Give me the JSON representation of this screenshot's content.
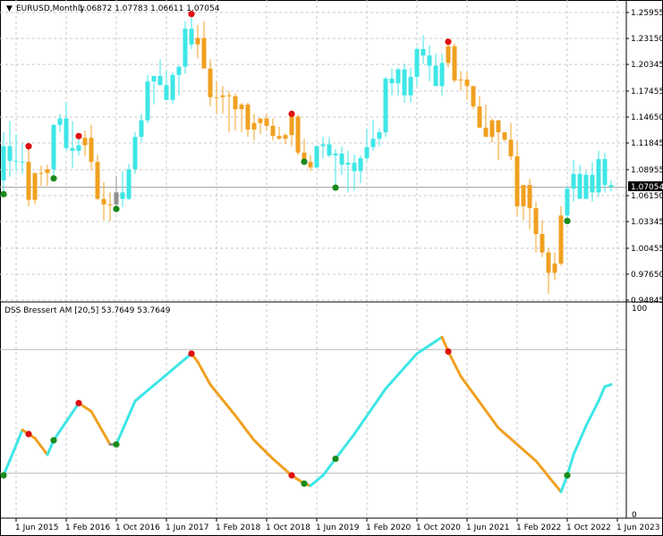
{
  "header": {
    "symbol_title": "EURUSD,Monthly",
    "ohlc": "1.06872 1.07783 1.06611 1.07054",
    "current_price_label": "1.07054"
  },
  "indicator": {
    "title": "DSS Bressert AM [20,5] 53.7649 53.7649",
    "level_max": "100",
    "level_min": "0"
  },
  "colors": {
    "bull": "#3ee6e6",
    "bear": "#f0a020",
    "neutral": "#909090",
    "signal_up": "#1a8a1a",
    "signal_down": "#e01010",
    "grid": "#c8c8c8"
  },
  "chart_data": [
    {
      "type": "candlestick",
      "symbol": "EURUSD",
      "timeframe": "Monthly",
      "ylim": [
        0.94845,
        1.25955
      ],
      "y_ticks": [
        "1.25955",
        "1.23150",
        "1.20345",
        "1.17455",
        "1.14650",
        "1.11845",
        "1.08955",
        "1.06150",
        "1.03345",
        "1.00455",
        "0.97650",
        "0.94845"
      ],
      "x_ticks": [
        "1 Jun 2015",
        "1 Feb 2016",
        "1 Oct 2016",
        "1 Jun 2017",
        "1 Feb 2018",
        "1 Oct 2018",
        "1 Jun 2019",
        "1 Feb 2020",
        "1 Oct 2020",
        "1 Jun 2021",
        "1 Feb 2022",
        "1 Oct 2022",
        "1 Jun 2023"
      ],
      "first_period": "2015-04",
      "current_price": 1.07054,
      "candles": [
        {
          "o": 1.078,
          "h": 1.13,
          "l": 1.066,
          "c": 1.115
        },
        {
          "o": 1.115,
          "h": 1.142,
          "l": 1.082,
          "c": 1.099
        },
        {
          "o": 1.099,
          "h": 1.128,
          "l": 1.088,
          "c": 1.098
        },
        {
          "o": 1.098,
          "h": 1.118,
          "l": 1.085,
          "c": 1.098
        },
        {
          "o": 1.098,
          "h": 1.112,
          "l": 1.05,
          "c": 1.057
        },
        {
          "o": 1.057,
          "h": 1.079,
          "l": 1.052,
          "c": 1.086
        },
        {
          "o": 1.086,
          "h": 1.094,
          "l": 1.072,
          "c": 1.086
        },
        {
          "o": 1.086,
          "h": 1.095,
          "l": 1.072,
          "c": 1.09
        },
        {
          "o": 1.09,
          "h": 1.139,
          "l": 1.083,
          "c": 1.138
        },
        {
          "o": 1.138,
          "h": 1.15,
          "l": 1.13,
          "c": 1.145
        },
        {
          "o": 1.145,
          "h": 1.163,
          "l": 1.11,
          "c": 1.113
        },
        {
          "o": 1.113,
          "h": 1.142,
          "l": 1.091,
          "c": 1.11
        },
        {
          "o": 1.11,
          "h": 1.123,
          "l": 1.105,
          "c": 1.116
        },
        {
          "o": 1.116,
          "h": 1.132,
          "l": 1.104,
          "c": 1.124
        },
        {
          "o": 1.124,
          "h": 1.138,
          "l": 1.089,
          "c": 1.098
        },
        {
          "o": 1.098,
          "h": 1.106,
          "l": 1.057,
          "c": 1.058
        },
        {
          "o": 1.058,
          "h": 1.076,
          "l": 1.035,
          "c": 1.052
        },
        {
          "o": 1.052,
          "h": 1.065,
          "l": 1.034,
          "c": 1.052
        },
        {
          "o": 1.052,
          "h": 1.083,
          "l": 1.05,
          "c": 1.065
        },
        {
          "o": 1.065,
          "h": 1.088,
          "l": 1.049,
          "c": 1.058
        },
        {
          "o": 1.058,
          "h": 1.096,
          "l": 1.057,
          "c": 1.09
        },
        {
          "o": 1.09,
          "h": 1.13,
          "l": 1.085,
          "c": 1.125
        },
        {
          "o": 1.125,
          "h": 1.15,
          "l": 1.12,
          "c": 1.143
        },
        {
          "o": 1.143,
          "h": 1.192,
          "l": 1.14,
          "c": 1.185
        },
        {
          "o": 1.185,
          "h": 1.191,
          "l": 1.16,
          "c": 1.191
        },
        {
          "o": 1.191,
          "h": 1.209,
          "l": 1.181,
          "c": 1.181
        },
        {
          "o": 1.181,
          "h": 1.197,
          "l": 1.165,
          "c": 1.165
        },
        {
          "o": 1.165,
          "h": 1.195,
          "l": 1.161,
          "c": 1.192
        },
        {
          "o": 1.192,
          "h": 1.202,
          "l": 1.17,
          "c": 1.201
        },
        {
          "o": 1.201,
          "h": 1.25,
          "l": 1.193,
          "c": 1.242
        },
        {
          "o": 1.242,
          "h": 1.255,
          "l": 1.22,
          "c": 1.225
        },
        {
          "o": 1.225,
          "h": 1.246,
          "l": 1.21,
          "c": 1.232
        },
        {
          "o": 1.232,
          "h": 1.25,
          "l": 1.217,
          "c": 1.199
        },
        {
          "o": 1.199,
          "h": 1.209,
          "l": 1.158,
          "c": 1.168
        },
        {
          "o": 1.168,
          "h": 1.185,
          "l": 1.15,
          "c": 1.168
        },
        {
          "o": 1.168,
          "h": 1.18,
          "l": 1.15,
          "c": 1.17
        },
        {
          "o": 1.17,
          "h": 1.175,
          "l": 1.13,
          "c": 1.169
        },
        {
          "o": 1.169,
          "h": 1.172,
          "l": 1.132,
          "c": 1.155
        },
        {
          "o": 1.155,
          "h": 1.162,
          "l": 1.13,
          "c": 1.16
        },
        {
          "o": 1.16,
          "h": 1.162,
          "l": 1.125,
          "c": 1.133
        },
        {
          "o": 1.133,
          "h": 1.15,
          "l": 1.121,
          "c": 1.14
        },
        {
          "o": 1.14,
          "h": 1.144,
          "l": 1.128,
          "c": 1.145
        },
        {
          "o": 1.145,
          "h": 1.15,
          "l": 1.132,
          "c": 1.137
        },
        {
          "o": 1.137,
          "h": 1.145,
          "l": 1.121,
          "c": 1.126
        },
        {
          "o": 1.126,
          "h": 1.136,
          "l": 1.122,
          "c": 1.123
        },
        {
          "o": 1.123,
          "h": 1.129,
          "l": 1.117,
          "c": 1.127
        },
        {
          "o": 1.127,
          "h": 1.147,
          "l": 1.115,
          "c": 1.147
        },
        {
          "o": 1.147,
          "h": 1.149,
          "l": 1.105,
          "c": 1.108
        },
        {
          "o": 1.108,
          "h": 1.123,
          "l": 1.101,
          "c": 1.098
        },
        {
          "o": 1.098,
          "h": 1.105,
          "l": 1.088,
          "c": 1.092
        },
        {
          "o": 1.092,
          "h": 1.115,
          "l": 1.091,
          "c": 1.115
        },
        {
          "o": 1.115,
          "h": 1.125,
          "l": 1.102,
          "c": 1.117
        },
        {
          "o": 1.117,
          "h": 1.125,
          "l": 1.103,
          "c": 1.105
        },
        {
          "o": 1.105,
          "h": 1.112,
          "l": 1.073,
          "c": 1.107
        },
        {
          "o": 1.107,
          "h": 1.115,
          "l": 1.084,
          "c": 1.095
        },
        {
          "o": 1.095,
          "h": 1.11,
          "l": 1.065,
          "c": 1.097
        },
        {
          "o": 1.097,
          "h": 1.106,
          "l": 1.067,
          "c": 1.088
        },
        {
          "o": 1.088,
          "h": 1.105,
          "l": 1.075,
          "c": 1.102
        },
        {
          "o": 1.102,
          "h": 1.134,
          "l": 1.099,
          "c": 1.114
        },
        {
          "o": 1.114,
          "h": 1.144,
          "l": 1.11,
          "c": 1.123
        },
        {
          "o": 1.123,
          "h": 1.134,
          "l": 1.115,
          "c": 1.13
        },
        {
          "o": 1.13,
          "h": 1.19,
          "l": 1.125,
          "c": 1.188
        },
        {
          "o": 1.188,
          "h": 1.199,
          "l": 1.17,
          "c": 1.183
        },
        {
          "o": 1.183,
          "h": 1.2,
          "l": 1.17,
          "c": 1.198
        },
        {
          "o": 1.198,
          "h": 1.204,
          "l": 1.162,
          "c": 1.17
        },
        {
          "o": 1.17,
          "h": 1.2,
          "l": 1.162,
          "c": 1.19
        },
        {
          "o": 1.19,
          "h": 1.222,
          "l": 1.18,
          "c": 1.22
        },
        {
          "o": 1.22,
          "h": 1.235,
          "l": 1.204,
          "c": 1.213
        },
        {
          "o": 1.213,
          "h": 1.224,
          "l": 1.185,
          "c": 1.202
        },
        {
          "o": 1.202,
          "h": 1.215,
          "l": 1.18,
          "c": 1.18
        },
        {
          "o": 1.18,
          "h": 1.215,
          "l": 1.17,
          "c": 1.205
        },
        {
          "o": 1.205,
          "h": 1.225,
          "l": 1.2,
          "c": 1.223
        },
        {
          "o": 1.223,
          "h": 1.226,
          "l": 1.184,
          "c": 1.186
        },
        {
          "o": 1.186,
          "h": 1.196,
          "l": 1.175,
          "c": 1.187
        },
        {
          "o": 1.187,
          "h": 1.195,
          "l": 1.165,
          "c": 1.18
        },
        {
          "o": 1.18,
          "h": 1.18,
          "l": 1.155,
          "c": 1.158
        },
        {
          "o": 1.158,
          "h": 1.169,
          "l": 1.135,
          "c": 1.135
        },
        {
          "o": 1.135,
          "h": 1.16,
          "l": 1.125,
          "c": 1.125
        },
        {
          "o": 1.125,
          "h": 1.145,
          "l": 1.119,
          "c": 1.143
        },
        {
          "o": 1.143,
          "h": 1.14,
          "l": 1.1,
          "c": 1.13
        },
        {
          "o": 1.13,
          "h": 1.13,
          "l": 1.12,
          "c": 1.122
        },
        {
          "o": 1.122,
          "h": 1.14,
          "l": 1.1,
          "c": 1.104
        },
        {
          "o": 1.104,
          "h": 1.12,
          "l": 1.04,
          "c": 1.05
        },
        {
          "o": 1.05,
          "h": 1.07,
          "l": 1.035,
          "c": 1.073
        },
        {
          "o": 1.073,
          "h": 1.08,
          "l": 1.025,
          "c": 1.048
        },
        {
          "o": 1.048,
          "h": 1.055,
          "l": 1.0,
          "c": 1.02
        },
        {
          "o": 1.02,
          "h": 1.035,
          "l": 0.995,
          "c": 1.0
        },
        {
          "o": 1.0,
          "h": 1.005,
          "l": 0.955,
          "c": 0.978
        },
        {
          "o": 0.978,
          "h": 1.0,
          "l": 0.97,
          "c": 0.988
        },
        {
          "o": 0.988,
          "h": 1.05,
          "l": 0.986,
          "c": 1.04
        },
        {
          "o": 1.04,
          "h": 1.072,
          "l": 1.037,
          "c": 1.069
        },
        {
          "o": 1.069,
          "h": 1.1,
          "l": 1.055,
          "c": 1.085
        },
        {
          "o": 1.085,
          "h": 1.095,
          "l": 1.06,
          "c": 1.058
        },
        {
          "o": 1.058,
          "h": 1.088,
          "l": 1.058,
          "c": 1.084
        },
        {
          "o": 1.084,
          "h": 1.098,
          "l": 1.055,
          "c": 1.065
        },
        {
          "o": 1.065,
          "h": 1.11,
          "l": 1.06,
          "c": 1.101
        },
        {
          "o": 1.101,
          "h": 1.108,
          "l": 1.065,
          "c": 1.073
        },
        {
          "o": 1.073,
          "h": 1.078,
          "l": 1.066,
          "c": 1.071
        }
      ],
      "signals_up": [
        0,
        8,
        18,
        48,
        53,
        90
      ],
      "signals_down": [
        4,
        12,
        30,
        46,
        71
      ]
    },
    {
      "type": "line",
      "name": "DSS Bressert AM [20,5]",
      "ylim": [
        0,
        100
      ],
      "levels": [
        80,
        20
      ],
      "y_ticks": [
        "100",
        "0"
      ],
      "keyframes": [
        [
          0,
          19
        ],
        [
          3,
          41
        ],
        [
          5,
          37
        ],
        [
          7,
          29
        ],
        [
          8,
          36
        ],
        [
          12,
          54
        ],
        [
          14,
          50
        ],
        [
          17,
          34
        ],
        [
          18,
          34
        ],
        [
          21,
          55
        ],
        [
          30,
          78
        ],
        [
          31,
          74
        ],
        [
          33,
          63
        ],
        [
          37,
          48
        ],
        [
          40,
          36
        ],
        [
          43,
          27
        ],
        [
          46,
          19
        ],
        [
          48,
          15
        ],
        [
          49,
          14
        ],
        [
          51,
          19
        ],
        [
          56,
          39
        ],
        [
          61,
          61
        ],
        [
          66,
          78
        ],
        [
          70,
          86
        ],
        [
          71,
          79
        ],
        [
          73,
          67
        ],
        [
          79,
          42
        ],
        [
          85,
          26
        ],
        [
          89,
          11
        ],
        [
          90,
          19
        ],
        [
          91,
          29
        ],
        [
          93,
          43
        ],
        [
          95,
          55
        ],
        [
          96,
          62
        ],
        [
          97,
          63
        ]
      ]
    }
  ]
}
